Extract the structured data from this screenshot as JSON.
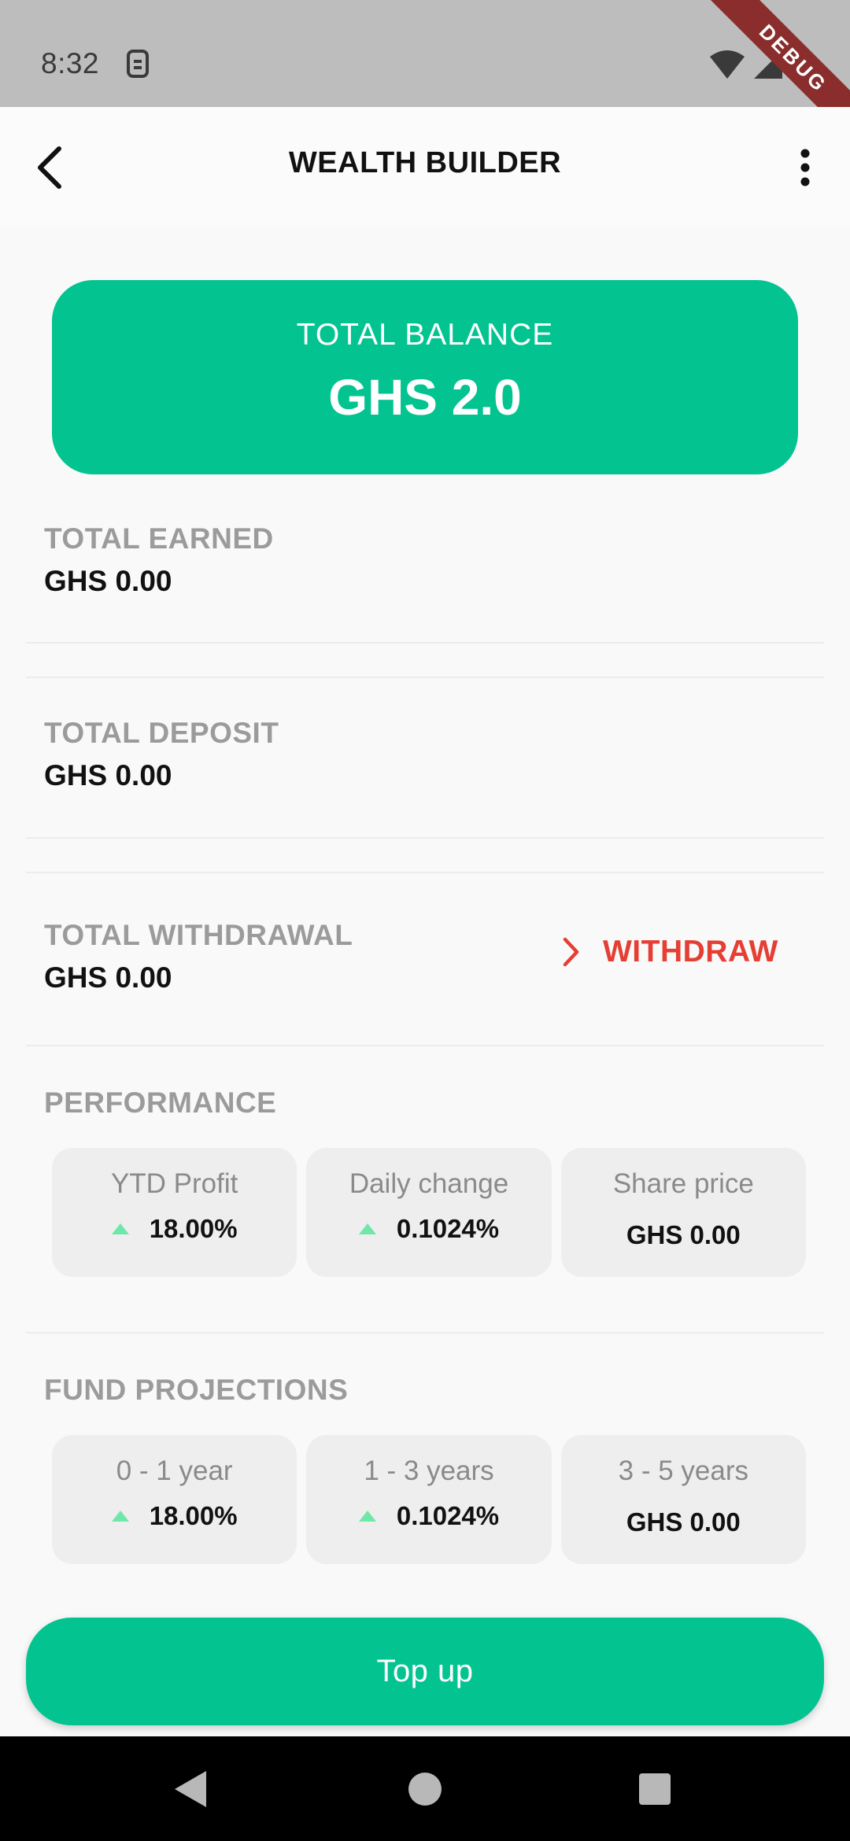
{
  "status_bar": {
    "time": "8:32",
    "debug_label": "DEBUG",
    "icons": [
      "sim-icon",
      "wifi-icon",
      "signal-icon",
      "battery-icon"
    ]
  },
  "app_bar": {
    "title": "WEALTH BUILDER",
    "back_icon": "back-arrow-icon",
    "more_icon": "more-vertical-icon"
  },
  "balance": {
    "label": "TOTAL BALANCE",
    "value": "GHS 2.0"
  },
  "stats": {
    "earned": {
      "label": "TOTAL EARNED",
      "value": "GHS 0.00"
    },
    "deposit": {
      "label": "TOTAL DEPOSIT",
      "value": "GHS 0.00"
    },
    "withdrawal": {
      "label": "TOTAL WITHDRAWAL",
      "value": "GHS 0.00"
    }
  },
  "withdraw_button": {
    "label": "WITHDRAW"
  },
  "performance": {
    "title": "PERFORMANCE",
    "cards": [
      {
        "label": "YTD Profit",
        "value": "18.00%",
        "trend": "up"
      },
      {
        "label": "Daily change",
        "value": "0.1024%",
        "trend": "up"
      },
      {
        "label": "Share price",
        "value": "GHS 0.00"
      }
    ]
  },
  "projections": {
    "title": "FUND PROJECTIONS",
    "cards": [
      {
        "label": "0 - 1 year",
        "value": "18.00%",
        "trend": "up"
      },
      {
        "label": "1 - 3 years",
        "value": "0.1024%",
        "trend": "up"
      },
      {
        "label": "3 - 5 years",
        "value": "GHS 0.00"
      }
    ]
  },
  "topup_button": {
    "label": "Top up"
  },
  "colors": {
    "accent": "#03c491",
    "danger": "#e53e33",
    "trend_up": "#6ee7a8"
  }
}
